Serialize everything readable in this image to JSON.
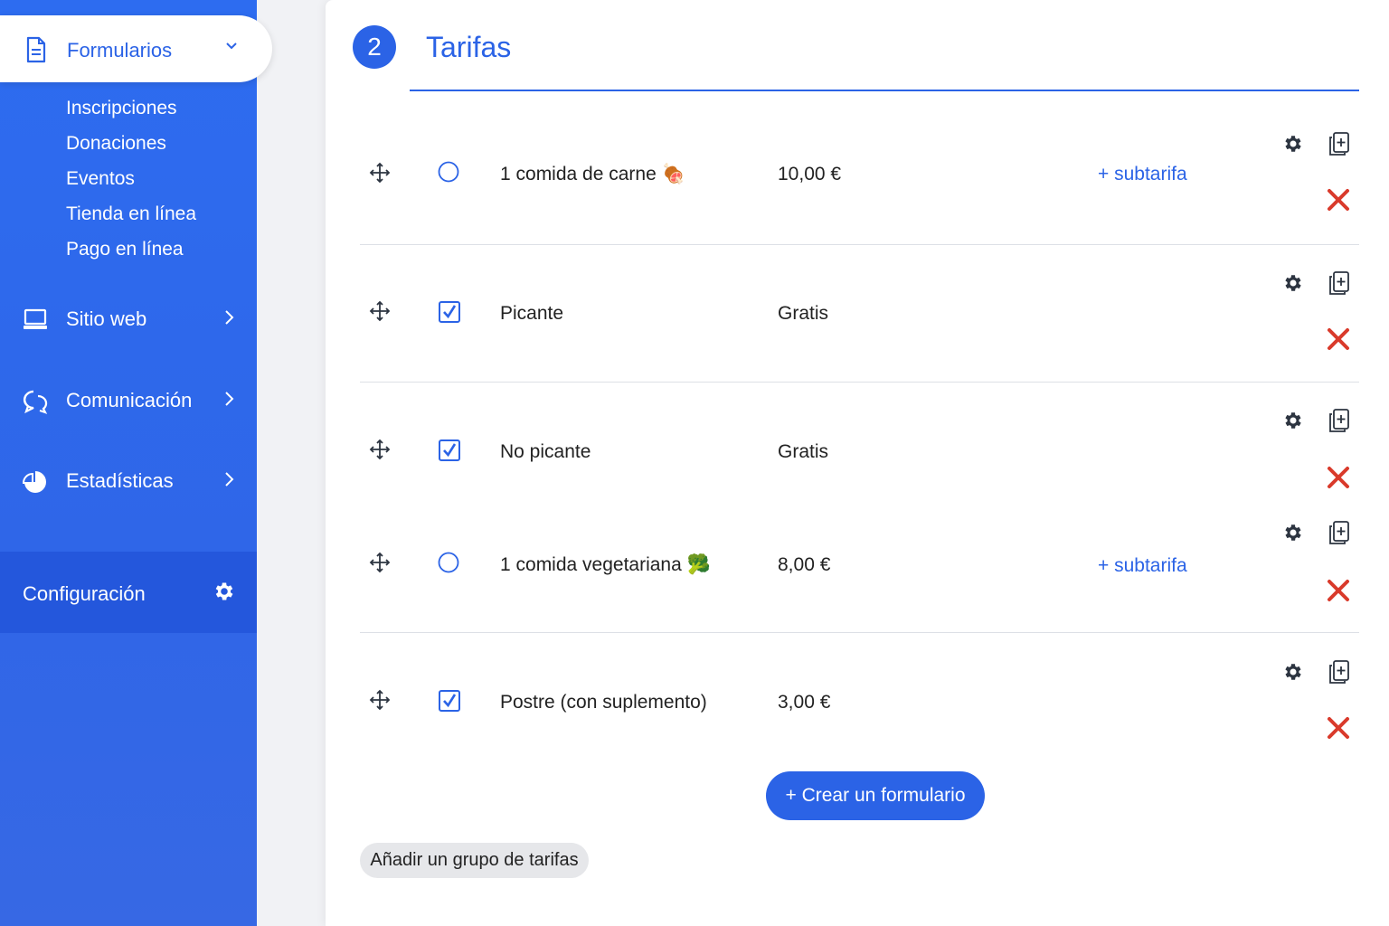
{
  "sidebar": {
    "active": {
      "label": "Formularios",
      "icon": "document-icon"
    },
    "submenu": [
      "Inscripciones",
      "Donaciones",
      "Eventos",
      "Tienda en línea",
      "Pago en línea"
    ],
    "items": [
      {
        "label": "Sitio web",
        "icon": "laptop-icon"
      },
      {
        "label": "Comunicación",
        "icon": "chat-bubbles-icon"
      },
      {
        "label": "Estadísticas",
        "icon": "pie-chart-icon"
      }
    ],
    "config": {
      "label": "Configuración",
      "icon": "gear-icon"
    }
  },
  "section": {
    "number": "2",
    "title": "Tarifas"
  },
  "rates": [
    {
      "name": "1 comida de carne 🍖",
      "price": "10,00 €",
      "selector": "radio",
      "subtarifa": "+ subtarifa"
    },
    {
      "name": "Picante",
      "price": "Gratis",
      "selector": "checkbox-checked"
    },
    {
      "name": "No picante",
      "price": "Gratis",
      "selector": "checkbox-checked"
    },
    {
      "name": "1 comida vegetariana 🥦",
      "price": "8,00 €",
      "selector": "radio",
      "subtarifa": "+ subtarifa"
    },
    {
      "name": "Postre (con suplemento)",
      "price": "3,00 €",
      "selector": "checkbox-checked"
    }
  ],
  "actions": {
    "create_form": "+ Crear un formulario",
    "add_group": "Añadir un grupo de tarifas"
  },
  "colors": {
    "primary": "#2b63e6",
    "delete": "#d93a2b",
    "icon_dark": "#2c3440"
  }
}
